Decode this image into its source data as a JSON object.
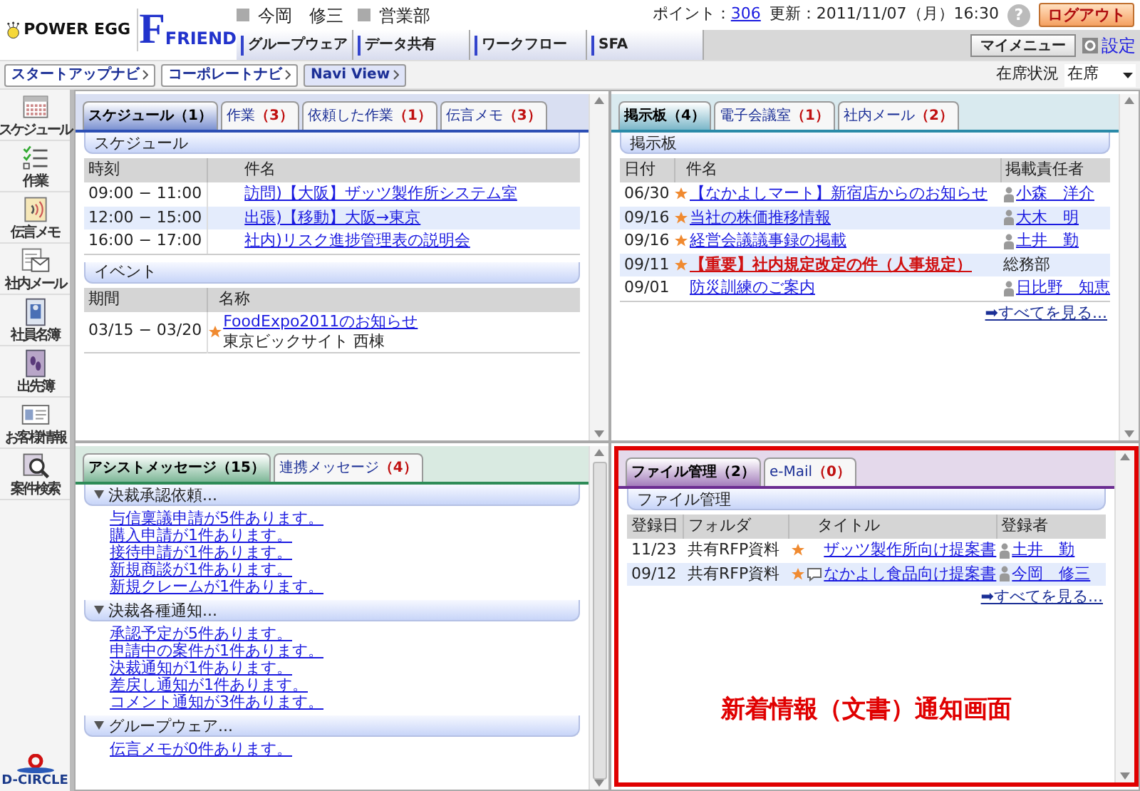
{
  "header": {
    "logo_text": "POWER EGG",
    "brand_initial": "F",
    "brand_name": "FRIEND"
  },
  "user": {
    "name": "今岡　修三",
    "department": "営業部"
  },
  "status": {
    "points_label": "ポイント：",
    "points": "306",
    "updated": "更新：2011/11/07（月）16:30",
    "help": "?",
    "logout": "ログアウト"
  },
  "nav_tabs": [
    "グループウェア",
    "データ共有",
    "ワークフロー",
    "SFA"
  ],
  "my_menu": "マイメニュー",
  "settings": "設定",
  "navi_buttons": [
    "スタートアップナビ",
    "コーポレートナビ",
    "Navi View"
  ],
  "presence": {
    "label": "在席状況",
    "value": "在席"
  },
  "sidebar": {
    "items": [
      "スケジュール",
      "作業",
      "伝言メモ",
      "社内メール",
      "社員名簿",
      "出先簿",
      "お客様情報",
      "案件検索"
    ],
    "footer_logo": "D-CIRCLE"
  },
  "panels": [
    {
      "kind": "schedule",
      "color": "#2c4fb5",
      "tabs": [
        {
          "label": "スケジュール",
          "count": "（1）",
          "selected": true
        },
        {
          "label": "作業",
          "count": "（3）",
          "selected": false
        },
        {
          "label": "依頼した作業",
          "count": "（1）",
          "selected": false
        },
        {
          "label": "伝言メモ",
          "count": "（3）",
          "selected": false
        }
      ],
      "schedule": {
        "title": "スケジュール",
        "columns": [
          "時刻",
          "件名"
        ],
        "rows": [
          {
            "time": "09:00 − 11:00",
            "title": "訪問)【大阪】ザッツ製作所システム室"
          },
          {
            "time": "12:00 − 15:00",
            "title": "出張)【移動】大阪→東京"
          },
          {
            "time": "16:00 − 17:00",
            "title": "社内)リスク進捗管理表の説明会"
          }
        ]
      },
      "events": {
        "title": "イベント",
        "columns": [
          "期間",
          "名称"
        ],
        "rows": [
          {
            "period": "03/15 − 03/20",
            "starred": true,
            "title": "FoodExpo2011のお知らせ",
            "place": "東京ビックサイト 西棟"
          }
        ]
      }
    },
    {
      "kind": "board",
      "color": "#2a8aa8",
      "tabs": [
        {
          "label": "掲示板",
          "count": "（4）",
          "selected": true
        },
        {
          "label": "電子会議室",
          "count": "（1）",
          "selected": false
        },
        {
          "label": "社内メール",
          "count": "（2）",
          "selected": false
        }
      ],
      "section_title": "掲示板",
      "columns": [
        "日付",
        "件名",
        "掲載責任者"
      ],
      "rows": [
        {
          "date": "06/30",
          "starred": true,
          "important": false,
          "title": "【なかよしマート】新宿店からのお知らせ",
          "poster": "小森　洋介",
          "person": true
        },
        {
          "date": "09/16",
          "starred": true,
          "important": false,
          "title": "当社の株価推移情報",
          "poster": "大木　明",
          "person": true
        },
        {
          "date": "09/16",
          "starred": true,
          "important": false,
          "title": "経営会議議事録の掲載",
          "poster": "土井　勤",
          "person": true
        },
        {
          "date": "09/11",
          "starred": true,
          "important": true,
          "title": "【重要】社内規定改定の件（人事規定）",
          "poster": "総務部",
          "person": false
        },
        {
          "date": "09/01",
          "starred": false,
          "important": false,
          "title": "防災訓練のご案内",
          "poster": "日比野　知恵",
          "person": true
        }
      ],
      "more": "➡すべてを見る..."
    },
    {
      "kind": "assist",
      "color": "#2e8b57",
      "tabs": [
        {
          "label": "アシストメッセージ",
          "count": "（15）",
          "selected": true
        },
        {
          "label": "連携メッセージ",
          "count": "（4）",
          "selected": false
        }
      ],
      "groups": [
        {
          "title": "決裁承認依頼...",
          "expanded": true,
          "items": [
            "与信稟議申請が5件あります。",
            "購入申請が1件あります。",
            "接待申請が1件あります。",
            "新規商談が1件あります。",
            "新規クレームが1件あります。"
          ]
        },
        {
          "title": "決裁各種通知...",
          "expanded": true,
          "items": [
            "承認予定が5件あります。",
            "申請中の案件が1件あります。",
            "決裁通知が1件あります。",
            "差戻し通知が1件あります。",
            "コメント通知が3件あります。"
          ]
        },
        {
          "title": "グループウェア...",
          "expanded": true,
          "items": [
            "伝言メモが0件あります。"
          ]
        }
      ]
    },
    {
      "kind": "files",
      "color": "#6b2c91",
      "tabs": [
        {
          "label": "ファイル管理",
          "count": "（2）",
          "selected": true
        },
        {
          "label": "e-Mail",
          "count": "（0）",
          "selected": false
        }
      ],
      "section_title": "ファイル管理",
      "columns": [
        "登録日",
        "フォルダ",
        "タイトル",
        "登録者"
      ],
      "rows": [
        {
          "date": "11/23",
          "folder": "共有RFP資料",
          "starred": true,
          "memo": false,
          "title": "ザッツ製作所向け提案書",
          "registrant": "土井　勤"
        },
        {
          "date": "09/12",
          "folder": "共有RFP資料",
          "starred": true,
          "memo": true,
          "title": "なかよし食品向け提案書",
          "registrant": "今岡　修三"
        }
      ],
      "more": "➡すべてを見る...",
      "annotation": "新着情報（文書）通知画面"
    }
  ]
}
